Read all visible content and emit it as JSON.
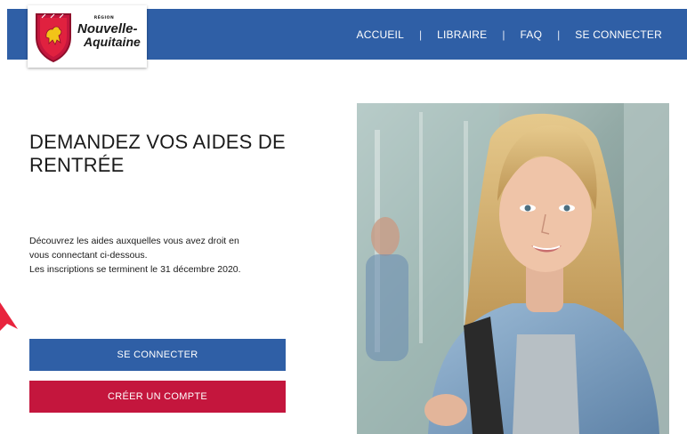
{
  "header": {
    "logo": {
      "small": "RÉGION",
      "line1": "Nouvelle-",
      "line2": "Aquitaine"
    },
    "nav": {
      "home": "ACCUEIL",
      "bookseller": "LIBRAIRE",
      "faq": "FAQ",
      "login": "SE CONNECTER",
      "separator": "|"
    }
  },
  "main": {
    "title": "DEMANDEZ VOS AIDES DE RENTRÉE",
    "intro_line1": "Découvrez les aides auxquelles vous avez droit en",
    "intro_line2": "vous connectant ci-dessous.",
    "intro_line3": "Les inscriptions se terminent le 31 décembre 2020.",
    "login_button": "SE CONNECTER",
    "create_button": "CRÉER UN COMPTE"
  },
  "colors": {
    "brand_blue": "#2f5fa6",
    "brand_red": "#c4163d",
    "arrow_red": "#e8243d"
  }
}
